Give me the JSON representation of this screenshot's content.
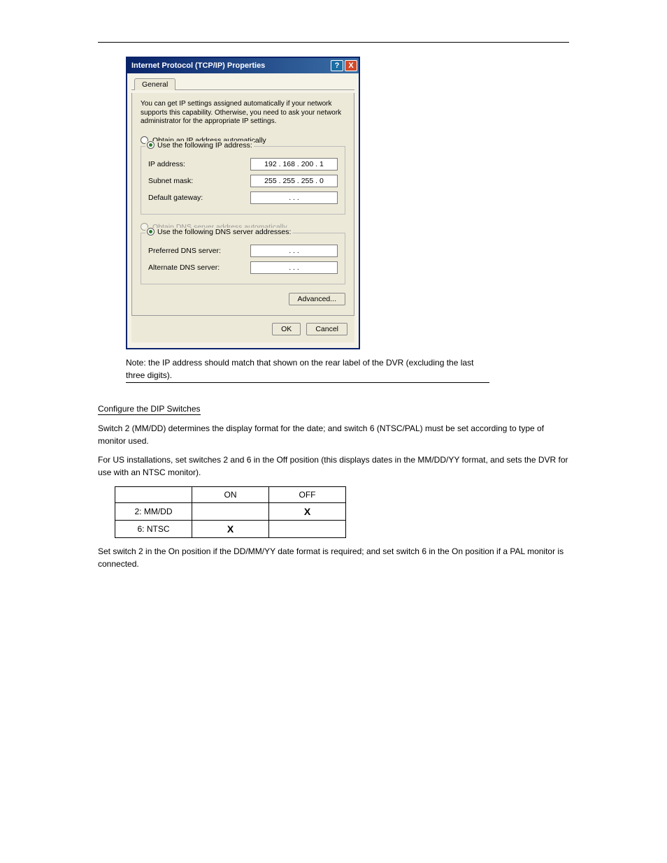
{
  "dialog": {
    "title": "Internet Protocol (TCP/IP) Properties",
    "tab": "General",
    "help_text": "You can get IP settings assigned automatically if your network supports this capability. Otherwise, you need to ask your network administrator for the appropriate IP settings.",
    "radio_obtain_ip": "Obtain an IP address automatically",
    "radio_use_ip": "Use the following IP address:",
    "ip_address_label": "IP address:",
    "ip_address_value": "192 . 168 . 200 .   1",
    "subnet_label": "Subnet mask:",
    "subnet_value": "255 . 255 . 255 .   0",
    "gateway_label": "Default gateway:",
    "gateway_value": ".       .       .",
    "radio_obtain_dns": "Obtain DNS server address automatically",
    "radio_use_dns": "Use the following DNS server addresses:",
    "pref_dns_label": "Preferred DNS server:",
    "pref_dns_value": ".       .       .",
    "alt_dns_label": "Alternate DNS server:",
    "alt_dns_value": ".       .       .",
    "advanced_btn": "Advanced...",
    "ok_btn": "OK",
    "cancel_btn": "Cancel"
  },
  "note_text": "Note: the IP address should match that shown on the rear label of the DVR (excluding the last three digits).",
  "section": {
    "heading": "Configure the DIP Switches",
    "p1": "Switch 2 (MM/DD) determines the display format for the date; and switch 6 (NTSC/PAL) must be set according to type of monitor used.",
    "p2": "For US installations, set switches 2 and 6 in the Off position (this displays dates in the MM/DD/YY format, and sets the DVR for use with an NTSC monitor).",
    "table": {
      "headers": [
        "",
        "ON",
        "OFF"
      ],
      "rows": [
        [
          "2: MM/DD",
          "",
          "X"
        ],
        [
          "6: NTSC",
          "X",
          ""
        ]
      ]
    },
    "p3": "Set switch 2 in the On position if the DD/MM/YY date format is required; and set switch 6 in the On position if a PAL monitor is connected."
  }
}
